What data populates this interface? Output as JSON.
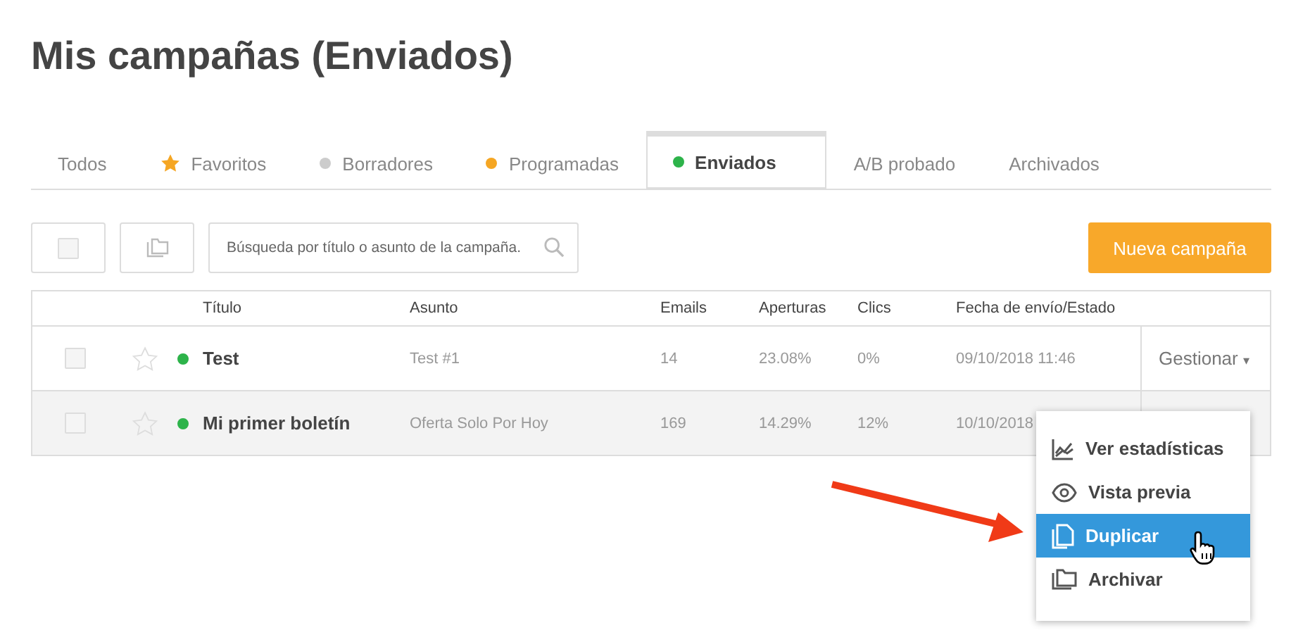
{
  "page_title": "Mis campañas (Enviados)",
  "tabs": [
    {
      "label": "Todos",
      "kind": "plain",
      "selected": false
    },
    {
      "label": "Favoritos",
      "kind": "starred",
      "color": "#f5a623",
      "selected": false
    },
    {
      "label": "Borradores",
      "kind": "status",
      "color": "#cccccc",
      "selected": false
    },
    {
      "label": "Programadas",
      "kind": "status",
      "color": "#f5a623",
      "selected": false
    },
    {
      "label": "Enviados",
      "kind": "status",
      "color": "#2db34a",
      "selected": true
    },
    {
      "label": "A/B probado",
      "kind": "plain",
      "selected": false
    },
    {
      "label": "Archivados",
      "kind": "plain",
      "selected": false
    }
  ],
  "toolbar": {
    "select_all_checked": false,
    "search_placeholder": "Búsqueda por título o asunto de la campaña.",
    "new_button": "Nueva campaña"
  },
  "table": {
    "columns": [
      "Título",
      "Asunto",
      "Emails",
      "Aperturas",
      "Clics",
      "Fecha de envío/Estado"
    ],
    "rows": [
      {
        "checked": false,
        "starred": false,
        "color": "#2db34a",
        "hovered": false,
        "cells": [
          "Test",
          "Test #1",
          "14",
          "23.08%",
          "0%",
          "09/10/2018 11:46"
        ],
        "action": "Gestionar",
        "caret": "▾"
      },
      {
        "checked": false,
        "starred": false,
        "color": "#2db34a",
        "hovered": true,
        "cells": [
          "Mi primer boletín",
          "Oferta Solo Por Hoy",
          "169",
          "14.29%",
          "12%",
          "10/10/2018"
        ]
      }
    ]
  },
  "menu": {
    "items": [
      {
        "label": "Ver estadísticas",
        "selected": false
      },
      {
        "label": "Vista previa",
        "selected": false
      },
      {
        "label": "Duplicar",
        "selected": true
      },
      {
        "label": "Archivar",
        "selected": false
      }
    ]
  }
}
